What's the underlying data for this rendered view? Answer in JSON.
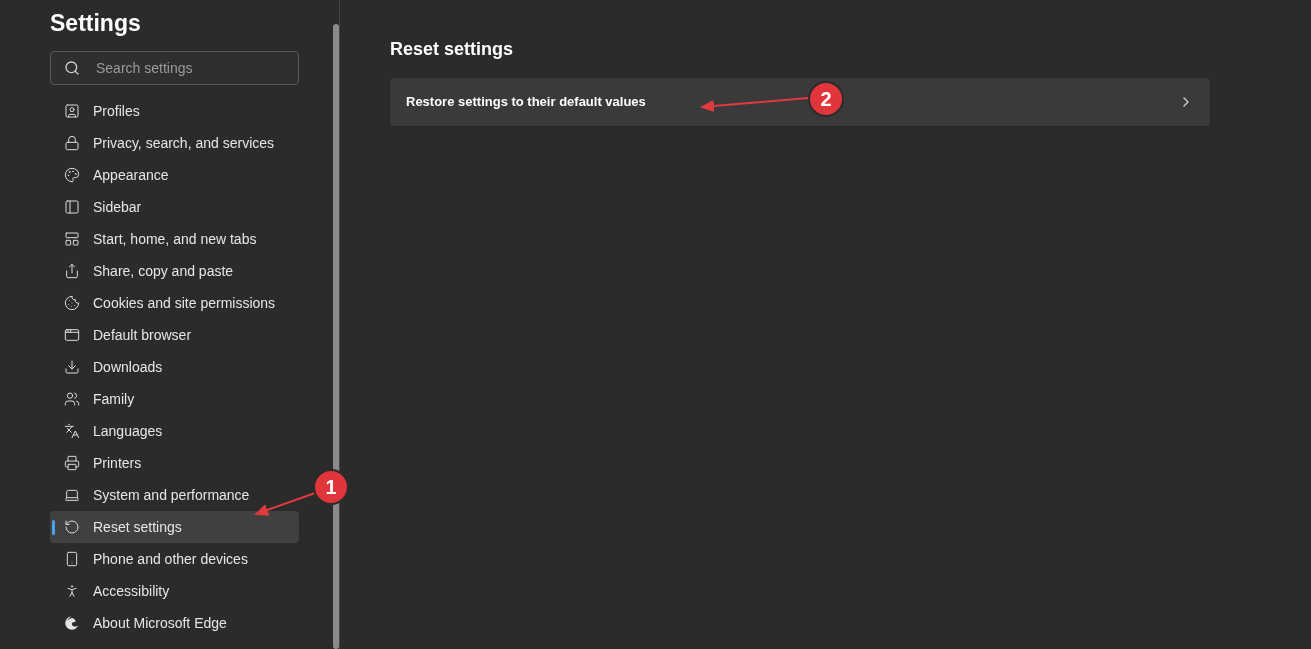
{
  "sidebar": {
    "title": "Settings",
    "search": {
      "placeholder": "Search settings"
    },
    "items": [
      {
        "label": "Profiles",
        "selected": false
      },
      {
        "label": "Privacy, search, and services",
        "selected": false
      },
      {
        "label": "Appearance",
        "selected": false
      },
      {
        "label": "Sidebar",
        "selected": false
      },
      {
        "label": "Start, home, and new tabs",
        "selected": false
      },
      {
        "label": "Share, copy and paste",
        "selected": false
      },
      {
        "label": "Cookies and site permissions",
        "selected": false
      },
      {
        "label": "Default browser",
        "selected": false
      },
      {
        "label": "Downloads",
        "selected": false
      },
      {
        "label": "Family",
        "selected": false
      },
      {
        "label": "Languages",
        "selected": false
      },
      {
        "label": "Printers",
        "selected": false
      },
      {
        "label": "System and performance",
        "selected": false
      },
      {
        "label": "Reset settings",
        "selected": true
      },
      {
        "label": "Phone and other devices",
        "selected": false
      },
      {
        "label": "Accessibility",
        "selected": false
      },
      {
        "label": "About Microsoft Edge",
        "selected": false
      }
    ]
  },
  "main": {
    "heading": "Reset settings",
    "rows": [
      {
        "label": "Restore settings to their default values"
      }
    ]
  },
  "annotations": [
    {
      "label": "1"
    },
    {
      "label": "2"
    }
  ]
}
